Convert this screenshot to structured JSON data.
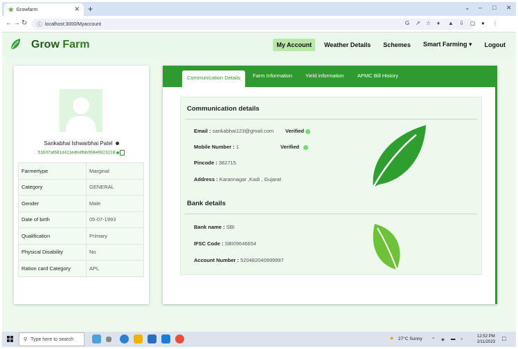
{
  "browser": {
    "tab_title": "Growfarm",
    "url": "localhost:3000/Myaccount"
  },
  "app": {
    "brand_part1": "Grow",
    "brand_part2": "Farm",
    "nav": [
      "My Account",
      "Weather Details",
      "Schemes",
      "Smart Farming ▾",
      "Logout"
    ],
    "active_nav": "My Account"
  },
  "profile": {
    "name": "Sankabhai Ishwarbhai Patel",
    "id": "51607af681d411edb4fbb068e6823218",
    "rows": [
      {
        "key": "Farmertype",
        "value": "Marginal"
      },
      {
        "key": "Category",
        "value": "GENERAL"
      },
      {
        "key": "Gender",
        "value": "Male"
      },
      {
        "key": "Date of birth",
        "value": "05-07-1993"
      },
      {
        "key": "Qualification",
        "value": "Primary"
      },
      {
        "key": "Physical Disability",
        "value": "No"
      },
      {
        "key": "Ration card Category",
        "value": "APL"
      }
    ]
  },
  "tabs": [
    "Communication Details",
    "Farm Information",
    "Yield information",
    "APMC Bill History"
  ],
  "communication": {
    "title": "Communication details",
    "email_label": "Email :",
    "email": "sankabhai123@gmail.com",
    "mobile_label": "Mobile Number :",
    "mobile": "1",
    "pincode_label": "Pincode :",
    "pincode": "382715",
    "address_label": "Address :",
    "address": "Karannagar ,Kadi , Gujarat",
    "verified": "Verified"
  },
  "bank": {
    "title": "Bank details",
    "name_label": "Bank name :",
    "name": "SBI",
    "ifsc_label": "IFSC Code :",
    "ifsc": "SBI09646654",
    "account_label": "Account Number :",
    "account": "520482040999997"
  },
  "taskbar": {
    "search_placeholder": "Type here to search",
    "weather": "27°C  Sunny",
    "time": "12:52 PM",
    "date": "2/11/2023"
  },
  "colors": {
    "brand_green": "#2f9a2f",
    "nav_bg": "#e9f8e9",
    "active_nav": "#b7e8a8"
  }
}
